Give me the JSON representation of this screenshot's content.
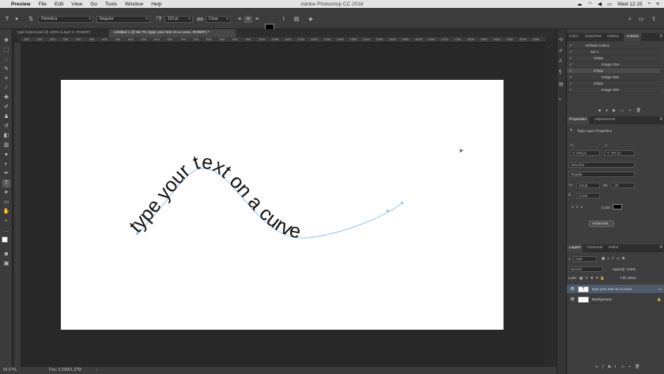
{
  "menubar": {
    "app": "Preview",
    "items": [
      "File",
      "Edit",
      "View",
      "Go",
      "Tools",
      "Window",
      "Help"
    ],
    "window_title": "Adobe Photoshop CC 2018",
    "clock": "Wed 12:15"
  },
  "options": {
    "font_family": "Helvetica",
    "font_style": "Regular",
    "font_size": "116 pt",
    "antialias": "Crisp"
  },
  "tabs": [
    "type basics.psd @ 100% (Layer 0, RGB/8*)",
    "Untitled-1 @ 66.7% (type your text on a curve, RGB/8*) *"
  ],
  "ruler_labels": [
    "100",
    "150",
    "200",
    "250",
    "300",
    "350",
    "400",
    "450",
    "500",
    "550",
    "600",
    "650",
    "700",
    "750",
    "800",
    "850",
    "900",
    "950",
    "1000",
    "1050",
    "1100",
    "1150",
    "1200",
    "1250",
    "1300",
    "1350",
    "1400",
    "1450",
    "1500",
    "1550",
    "1600",
    "1650",
    "1700",
    "1750",
    "1800",
    "1850",
    "1900",
    "1950",
    "2000",
    "2050"
  ],
  "canvas": {
    "curve_text": "type your text on a curve"
  },
  "status": {
    "zoom": "66.67%",
    "doc": "Doc: 5.93M/1.37M"
  },
  "panels": {
    "top_tabs": [
      "Color",
      "Swatches",
      "History",
      "Actions"
    ],
    "actions": [
      {
        "label": "Default Actions",
        "indent": 0
      },
      {
        "label": "Set 1",
        "indent": 1
      },
      {
        "label": "333px",
        "indent": 2
      },
      {
        "label": "Image Size",
        "indent": 3
      },
      {
        "label": "675px",
        "indent": 2
      },
      {
        "label": "Image Size",
        "indent": 3
      },
      {
        "label": "333px",
        "indent": 2
      },
      {
        "label": "Image Size",
        "indent": 3
      }
    ],
    "props_tabs": [
      "Properties",
      "Adjustments"
    ],
    "props_title": "Type Layer Properties",
    "props_w": "W:",
    "props_h": "H:",
    "props_x": "X: 283 px",
    "props_y": "Y: 297 px",
    "props_font": "Helvetica",
    "props_style": "Regular",
    "props_size": "116 pt",
    "props_tracking": "-25",
    "props_leading": "(Auto)",
    "props_color_label": "Color:",
    "props_advanced": "Advanced...",
    "layers_tabs": [
      "Layers",
      "Channels",
      "Paths"
    ],
    "layers_kind": "Kind",
    "layers_blend": "Normal",
    "layers_opacity": "Opacity: 100%",
    "layers_lock": "Lock:",
    "layers_fill": "Fill: 100%",
    "layers": [
      {
        "name": "type your text on a curve",
        "thumb": "T",
        "selected": true
      },
      {
        "name": "Background",
        "thumb": "",
        "selected": false
      }
    ]
  }
}
